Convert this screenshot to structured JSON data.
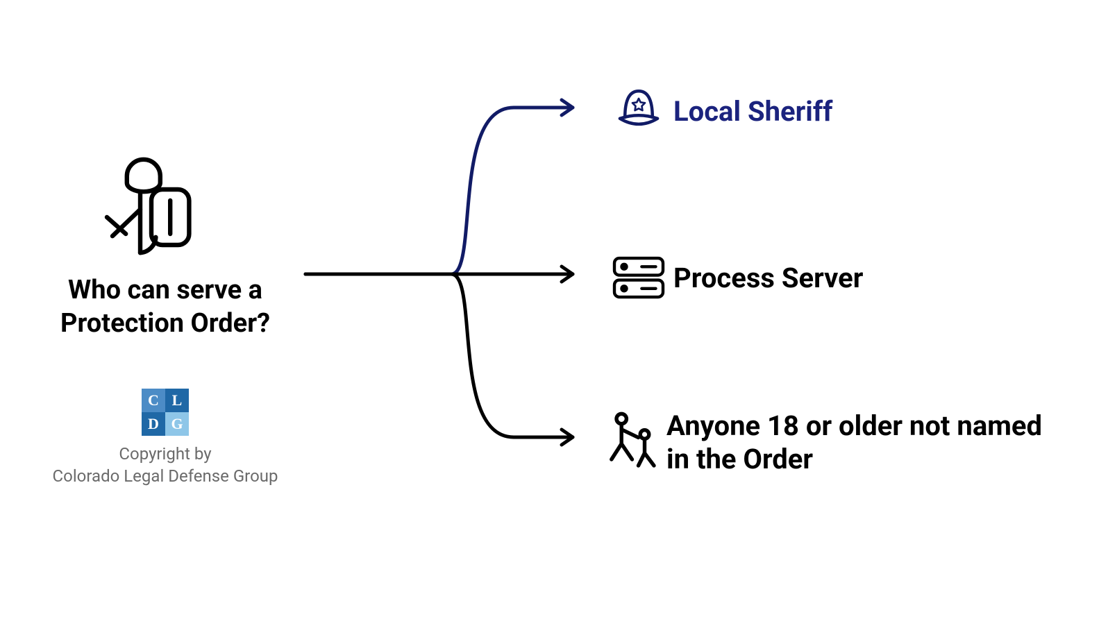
{
  "title": "Who can serve a Protection Order?",
  "copyright_line1": "Copyright by",
  "copyright_line2": "Colorado Legal Defense Group",
  "logo_letters": {
    "tl": "C",
    "tr": "L",
    "bl": "D",
    "br": "G"
  },
  "options": {
    "sheriff": "Local Sheriff",
    "process_server": "Process Server",
    "anyone": "Anyone 18 or older not named in the Order"
  },
  "colors": {
    "highlight": "#1b237e",
    "text": "#000000",
    "sub": "#6a6a6a"
  }
}
